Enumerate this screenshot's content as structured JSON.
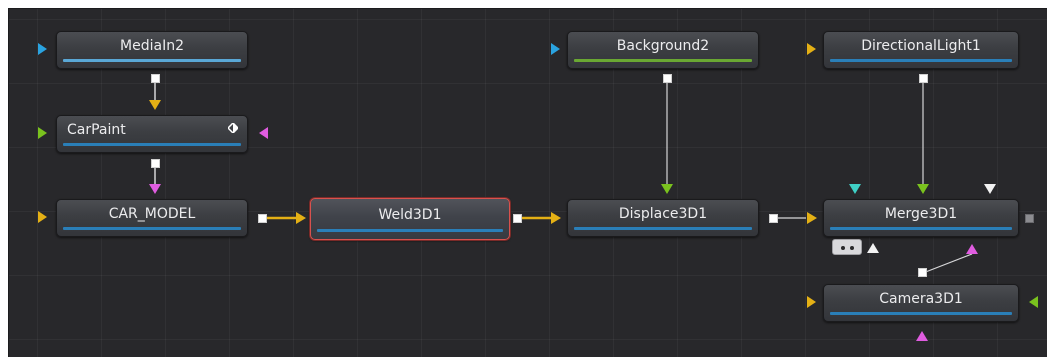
{
  "nodes": {
    "mediain2": {
      "label": "MediaIn2",
      "bar_color": "#5aa8d6"
    },
    "carpaint": {
      "label": "CarPaint",
      "bar_color": "#2a7fb8"
    },
    "car_model": {
      "label": "CAR_MODEL",
      "bar_color": "#2a7fb8"
    },
    "weld3d1": {
      "label": "Weld3D1",
      "bar_color": "#2a7fb8",
      "selected": true
    },
    "background2": {
      "label": "Background2",
      "bar_color": "#6aa833"
    },
    "displace3d1": {
      "label": "Displace3D1",
      "bar_color": "#2a7fb8"
    },
    "directionallight1": {
      "label": "DirectionalLight1",
      "bar_color": "#2a7fb8"
    },
    "merge3d1": {
      "label": "Merge3D1",
      "bar_color": "#2a7fb8"
    },
    "camera3d1": {
      "label": "Camera3D1",
      "bar_color": "#2a7fb8"
    }
  },
  "port_colors": {
    "yellow": "#e4b015",
    "blue": "#2aa3e0",
    "green": "#7ac21e",
    "pink": "#e05ce0",
    "cyan": "#3fd0c6",
    "white": "#f2f2f2",
    "wire": "#d6d6d8",
    "wire_active": "#e4b015"
  },
  "icons": {
    "view_indicator": "diamond-icon",
    "port_shape": "triangle"
  }
}
